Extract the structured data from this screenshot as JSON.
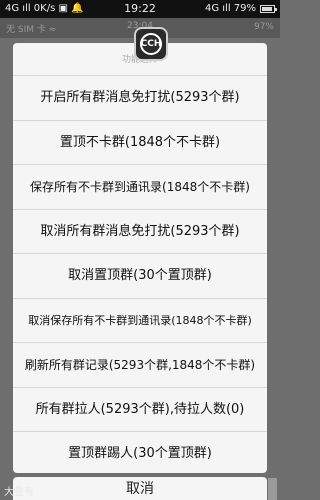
{
  "status_bar": {
    "left": "4G ıll 0K/s ▣ 🔔",
    "time": "19:22",
    "right": "4G ıll 79%"
  },
  "background_bar": {
    "left": "无 SIM 卡 ≈",
    "center": "23:04",
    "right": "97%"
  },
  "logo": {
    "text": "CCH"
  },
  "sheet": {
    "title": "功能选择",
    "items": [
      "开启所有群消息免打扰(5293个群)",
      "置顶不卡群(1848个不卡群)",
      "保存所有不卡群到通讯录(1848个不卡群)",
      "取消所有群消息免打扰(5293个群)",
      "取消置顶群(30个置顶群)",
      "取消保存所有不卡群到通讯录(1848个不卡群)",
      "刷新所有群记录(5293个群,1848个不卡群)",
      "所有群拉人(5293个群),待拉人数(0)",
      "置顶群踢人(30个置顶群)"
    ]
  },
  "cancel_label": "取消",
  "bottom_left_label": "大量有"
}
